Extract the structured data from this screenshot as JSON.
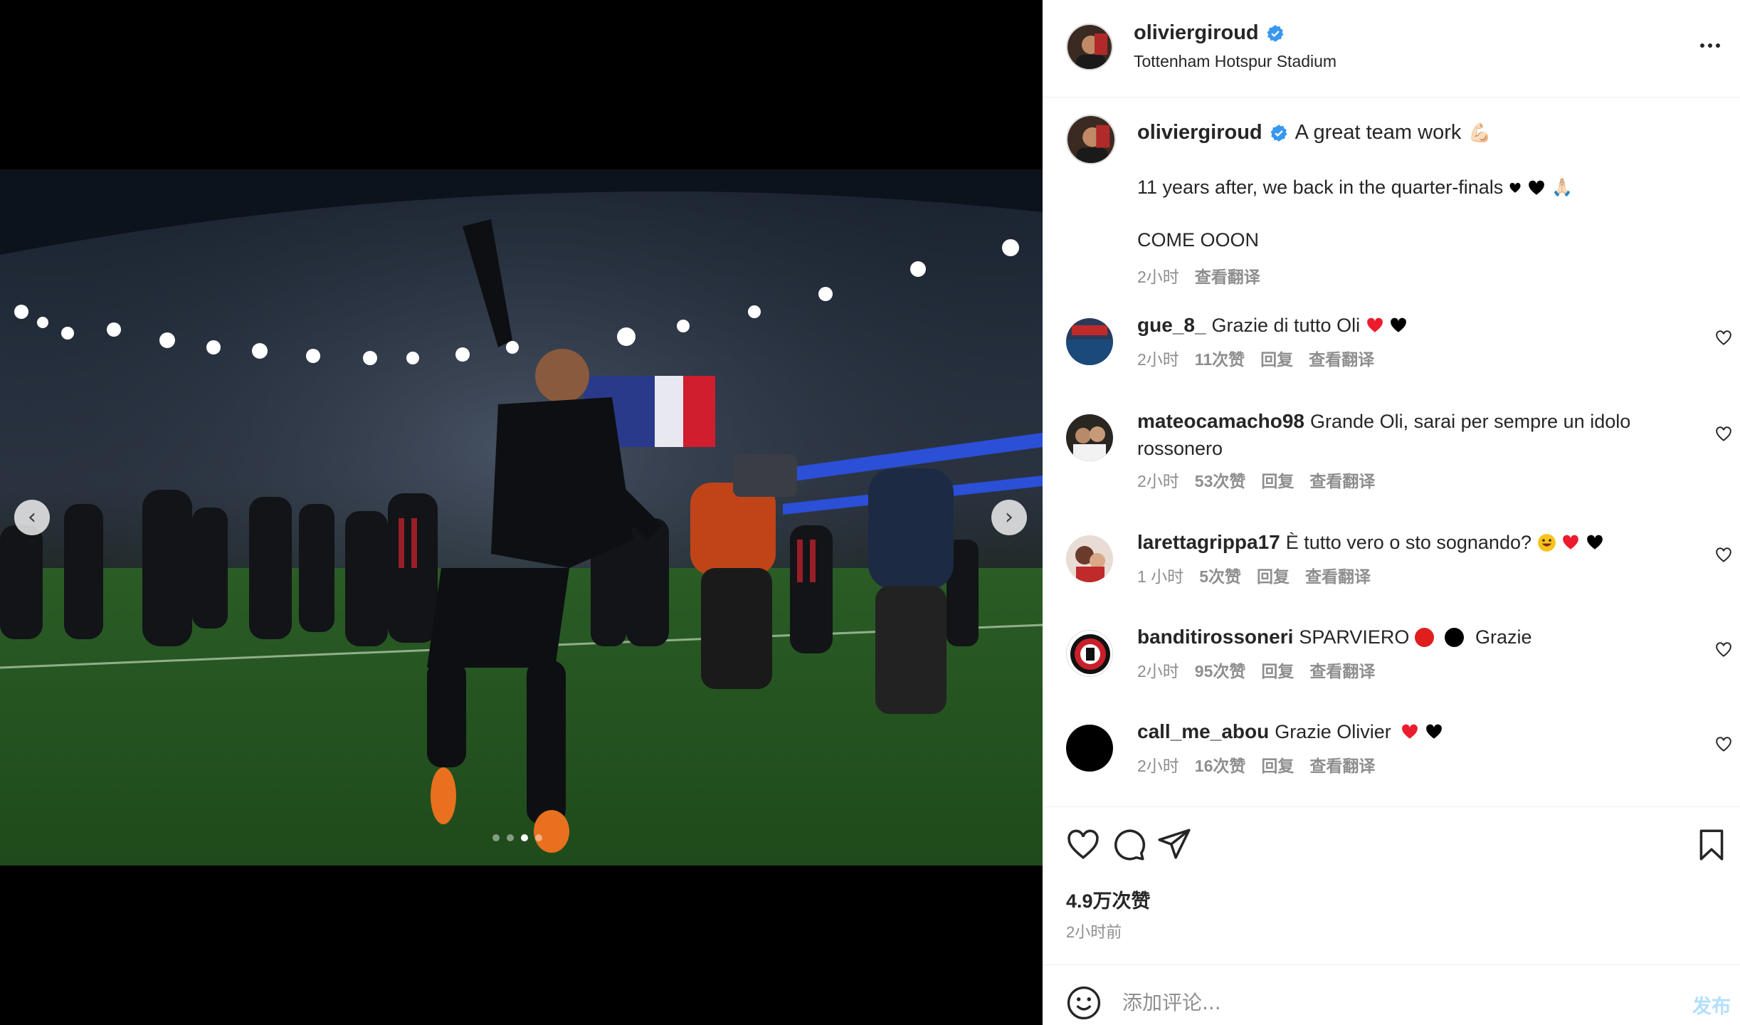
{
  "post": {
    "username": "oliviergiroud",
    "location": "Tottenham Hotspur Stadium",
    "verified": true
  },
  "caption": {
    "username": "oliviergiroud",
    "line1": "A great team work",
    "line1_emoji": "💪🏻",
    "line2": "11 years after, we back in the quarter-finals",
    "line2_emoji": "🙏🏻",
    "line3": "COME OOON",
    "time": "2小时",
    "translate": "查看翻译"
  },
  "comments": [
    {
      "username": "gue_8_",
      "text": "Grazie di tutto Oli",
      "time": "2小时",
      "likes": "11次赞",
      "reply": "回复",
      "translate": "查看翻译"
    },
    {
      "username": "mateocamacho98",
      "text": "Grande Oli, sarai per sempre un idolo rossonero",
      "time": "2小时",
      "likes": "53次赞",
      "reply": "回复",
      "translate": "查看翻译"
    },
    {
      "username": "larettagrippa17",
      "text": "È tutto vero o sto sognando?",
      "time": "1 小时",
      "likes": "5次赞",
      "reply": "回复",
      "translate": "查看翻译"
    },
    {
      "username": "banditirossoneri",
      "text": "SPARVIERO",
      "text_after": "Grazie",
      "time": "2小时",
      "likes": "95次赞",
      "reply": "回复",
      "translate": "查看翻译"
    },
    {
      "username": "call_me_abou",
      "text": "Grazie Olivier",
      "time": "2小时",
      "likes": "16次赞",
      "reply": "回复",
      "translate": "查看翻译"
    }
  ],
  "stats": {
    "likes": "4.9万次赞",
    "posted": "2小时前"
  },
  "composer": {
    "placeholder": "添加评论...",
    "post_label": "发布"
  },
  "carousel": {
    "slide_count": 4,
    "active_index": 2
  },
  "colors": {
    "verified": "#3897f0",
    "heart_red": "#ed1b2e",
    "post_button_disabled": "#b2dffc",
    "muted_text": "#8e8e8e"
  },
  "icons": [
    "verified-badge-icon",
    "more-options-icon",
    "heart-icon",
    "comment-icon",
    "share-icon",
    "bookmark-icon",
    "emoji-icon",
    "chevron-left-icon",
    "chevron-right-icon"
  ]
}
